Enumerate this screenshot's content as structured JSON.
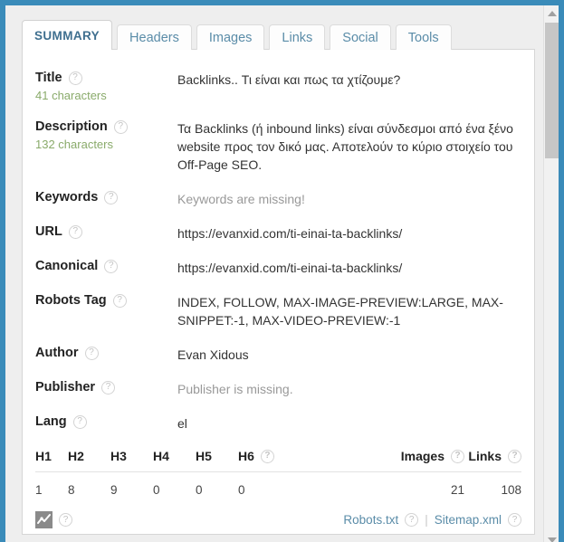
{
  "window": {
    "border_color": "#3a8bb9",
    "background": "#eeeeee"
  },
  "scrollbar": {
    "up_arrow": "scroll-up",
    "down_arrow": "scroll-down",
    "thumb": "scroll-thumb"
  },
  "tabs": [
    {
      "label": "SUMMARY",
      "active": true
    },
    {
      "label": "Headers",
      "active": false
    },
    {
      "label": "Images",
      "active": false
    },
    {
      "label": "Links",
      "active": false
    },
    {
      "label": "Social",
      "active": false
    },
    {
      "label": "Tools",
      "active": false
    }
  ],
  "help_glyph": "?",
  "rows": [
    {
      "label": "Title",
      "count": "41 characters",
      "value": "Backlinks.. Τι είναι και πως τα χτίζουμε?",
      "muted": false
    },
    {
      "label": "Description",
      "count": "132 characters",
      "value": "Τα Backlinks (ή inbound links) είναι σύνδεσμοι από ένα ξένο website προς τον δικό μας. Αποτελούν το κύριο στοιχείο του Off-Page SEO.",
      "muted": false
    },
    {
      "label": "Keywords",
      "count": "",
      "value": "Keywords are missing!",
      "muted": true
    },
    {
      "label": "URL",
      "count": "",
      "value": "https://evanxid.com/ti-einai-ta-backlinks/",
      "muted": false
    },
    {
      "label": "Canonical",
      "count": "",
      "value": "https://evanxid.com/ti-einai-ta-backlinks/",
      "muted": false
    },
    {
      "label": "Robots Tag",
      "count": "",
      "value": "INDEX, FOLLOW, MAX-IMAGE-PREVIEW:LARGE, MAX-SNIPPET:-1, MAX-VIDEO-PREVIEW:-1",
      "muted": false
    },
    {
      "label": "Author",
      "count": "",
      "value": "Evan Xidous",
      "muted": false
    },
    {
      "label": "Publisher",
      "count": "",
      "value": "Publisher is missing.",
      "muted": true
    },
    {
      "label": "Lang",
      "count": "",
      "value": "el",
      "muted": false
    }
  ],
  "headings_table": {
    "columns": [
      {
        "label": "H1",
        "help": false,
        "align": "left"
      },
      {
        "label": "H2",
        "help": false,
        "align": "left"
      },
      {
        "label": "H3",
        "help": false,
        "align": "left"
      },
      {
        "label": "H4",
        "help": false,
        "align": "left"
      },
      {
        "label": "H5",
        "help": false,
        "align": "left"
      },
      {
        "label": "H6",
        "help": true,
        "align": "left"
      },
      {
        "label": "Images",
        "help": true,
        "align": "right"
      },
      {
        "label": "Links",
        "help": true,
        "align": "right"
      }
    ],
    "values": [
      "1",
      "8",
      "9",
      "0",
      "0",
      "0",
      "21",
      "108"
    ]
  },
  "footer": {
    "chart_icon": "line-chart-icon",
    "robots_link": "Robots.txt",
    "separator": "|",
    "sitemap_link": "Sitemap.xml"
  }
}
